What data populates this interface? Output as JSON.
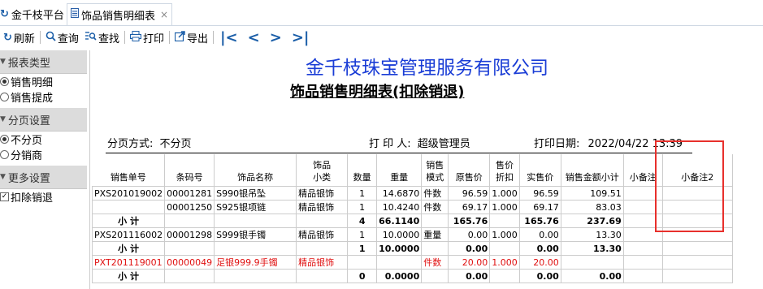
{
  "tabs": [
    {
      "label": "金千枝平台"
    },
    {
      "label": "饰品销售明细表",
      "close": "×"
    }
  ],
  "toolbar": {
    "refresh": "刷新",
    "query": "查询",
    "find": "查找",
    "print": "打印",
    "export": "导出"
  },
  "sidebar": {
    "report_type": {
      "header": "报表类型",
      "options": [
        "销售明细",
        "销售提成"
      ],
      "selected": "销售明细"
    },
    "paging": {
      "header": "分页设置",
      "options": [
        "不分页",
        "分销商"
      ],
      "selected": "不分页"
    },
    "more": {
      "header": "更多设置",
      "check_label": "扣除销退",
      "checked": true
    }
  },
  "report": {
    "company": "金千枝珠宝管理服务有限公司",
    "title": "饰品销售明细表(扣除销退)",
    "paging_label": "分页方式:",
    "paging_value": "不分页",
    "printer_label": "打 印 人:",
    "printer_value": "超级管理员",
    "date_label": "打印日期:",
    "date_value": "2022/04/22 13:39"
  },
  "table": {
    "headers": [
      "销售单号",
      "条码号",
      "饰品名称",
      "饰品\n小类",
      "数量",
      "重量",
      "销售\n模式",
      "原售价",
      "售价\n折扣",
      "实售价",
      "销售金额小计",
      "小备注",
      "小备注2"
    ],
    "rows": [
      {
        "type": "data",
        "cells": [
          "PXS201019002",
          "00001281",
          "S990银吊坠",
          "精品银饰",
          "1",
          "14.6870",
          "件数",
          "96.59",
          "1.000",
          "96.59",
          "109.51",
          "",
          ""
        ]
      },
      {
        "type": "data",
        "cells": [
          "",
          "00001250",
          "S925银项链",
          "精品银饰",
          "1",
          "10.4240",
          "件数",
          "69.17",
          "1.000",
          "69.17",
          "83.03",
          "",
          ""
        ]
      },
      {
        "type": "sub",
        "cells": [
          "小 计",
          "",
          "",
          "",
          "4",
          "66.1140",
          "",
          "165.76",
          "",
          "165.76",
          "237.69",
          "",
          ""
        ]
      },
      {
        "type": "data",
        "cells": [
          "PXS201116002",
          "00001298",
          "S999银手镯",
          "精品银饰",
          "1",
          "10.0000",
          "重量",
          "0.00",
          "1.000",
          "0.00",
          "13.30",
          "",
          ""
        ]
      },
      {
        "type": "sub",
        "cells": [
          "小 计",
          "",
          "",
          "",
          "1",
          "10.0000",
          "",
          "0.00",
          "",
          "0.00",
          "13.30",
          "",
          ""
        ]
      },
      {
        "type": "red",
        "cells": [
          "PXT201119001",
          "00000049",
          "足银999.9手镯",
          "精品银饰",
          "",
          "",
          "件数",
          "20.00",
          "1.000",
          "20.00",
          "",
          "",
          ""
        ]
      },
      {
        "type": "sub",
        "cells": [
          "小 计",
          "",
          "",
          "",
          "0",
          "0.0000",
          "",
          "0.00",
          "",
          "0.00",
          "0.00",
          "",
          ""
        ]
      }
    ]
  }
}
